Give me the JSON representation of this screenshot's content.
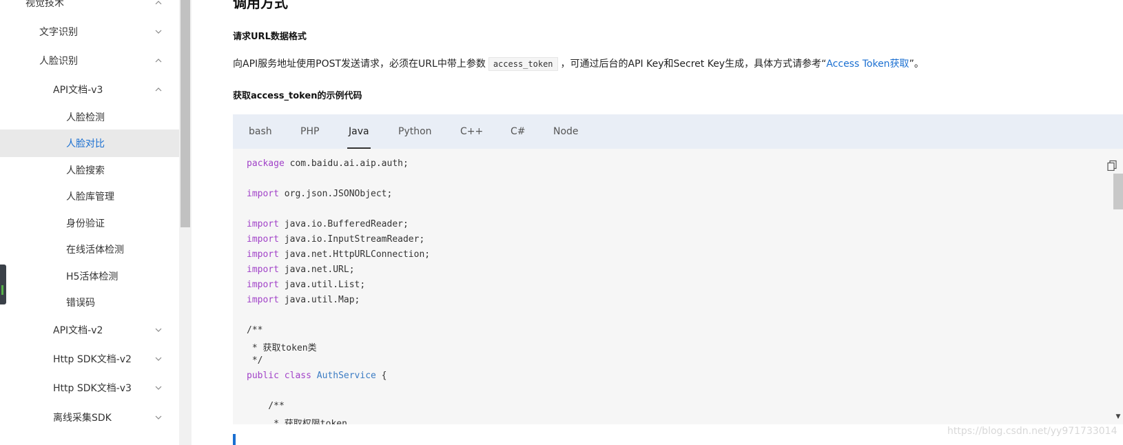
{
  "sidebar": {
    "items": [
      {
        "label": "视觉技术",
        "chevron": "up"
      },
      {
        "label": "文字识别",
        "chevron": "down"
      },
      {
        "label": "人脸识别",
        "chevron": "up"
      },
      {
        "label": "API文档-v3",
        "chevron": "up"
      },
      {
        "label": "人脸检测"
      },
      {
        "label": "人脸对比",
        "active": true
      },
      {
        "label": "人脸搜索"
      },
      {
        "label": "人脸库管理"
      },
      {
        "label": "身份验证"
      },
      {
        "label": "在线活体检测"
      },
      {
        "label": "H5活体检测"
      },
      {
        "label": "错误码"
      },
      {
        "label": "API文档-v2",
        "chevron": "down"
      },
      {
        "label": "Http SDK文档-v2",
        "chevron": "down"
      },
      {
        "label": "Http SDK文档-v3",
        "chevron": "down"
      },
      {
        "label": "离线采集SDK",
        "chevron": "down"
      }
    ]
  },
  "main": {
    "section_title": "调用方式",
    "url_format_heading": "请求URL数据格式",
    "para": {
      "before": "向API服务地址使用POST发送请求，必须在URL中带上参数",
      "code": "access_token",
      "middle": "，可通过后台的API Key和Secret Key生成，具体方式请参考“",
      "link": "Access Token获取",
      "after": "”。"
    },
    "sample_heading": "获取access_token的示例代码",
    "tabs": [
      "bash",
      "PHP",
      "Java",
      "Python",
      "C++",
      "C#",
      "Node"
    ],
    "active_tab": "Java",
    "code_lines": [
      [
        [
          "kw",
          "package"
        ],
        [
          "",
          " com.baidu.ai.aip.auth;"
        ]
      ],
      [],
      [
        [
          "kw",
          "import"
        ],
        [
          "",
          " org.json.JSONObject;"
        ]
      ],
      [],
      [
        [
          "kw",
          "import"
        ],
        [
          "",
          " java.io.BufferedReader;"
        ]
      ],
      [
        [
          "kw",
          "import"
        ],
        [
          "",
          " java.io.InputStreamReader;"
        ]
      ],
      [
        [
          "kw",
          "import"
        ],
        [
          "",
          " java.net.HttpURLConnection;"
        ]
      ],
      [
        [
          "kw",
          "import"
        ],
        [
          "",
          " java.net.URL;"
        ]
      ],
      [
        [
          "kw",
          "import"
        ],
        [
          "",
          " java.util.List;"
        ]
      ],
      [
        [
          "kw",
          "import"
        ],
        [
          "",
          " java.util.Map;"
        ]
      ],
      [],
      [
        [
          "",
          "/**"
        ]
      ],
      [
        [
          "",
          " * 获取token类"
        ]
      ],
      [
        [
          "",
          " */"
        ]
      ],
      [
        [
          "kw",
          "public"
        ],
        [
          "",
          " "
        ],
        [
          "kw",
          "class"
        ],
        [
          "",
          " "
        ],
        [
          "cls",
          "AuthService"
        ],
        [
          "",
          " {"
        ]
      ],
      [],
      [
        [
          "",
          "    /**"
        ]
      ],
      [
        [
          "",
          "     * 获取权限token"
        ]
      ]
    ],
    "copy_icon": "copy-icon"
  },
  "watermark": "https://blog.csdn.net/yy971733014",
  "colors": {
    "link": "#1a6fd1",
    "keyword": "#a142c8",
    "class_name": "#3b7cc4",
    "tab_bar": "#e9eef6"
  }
}
